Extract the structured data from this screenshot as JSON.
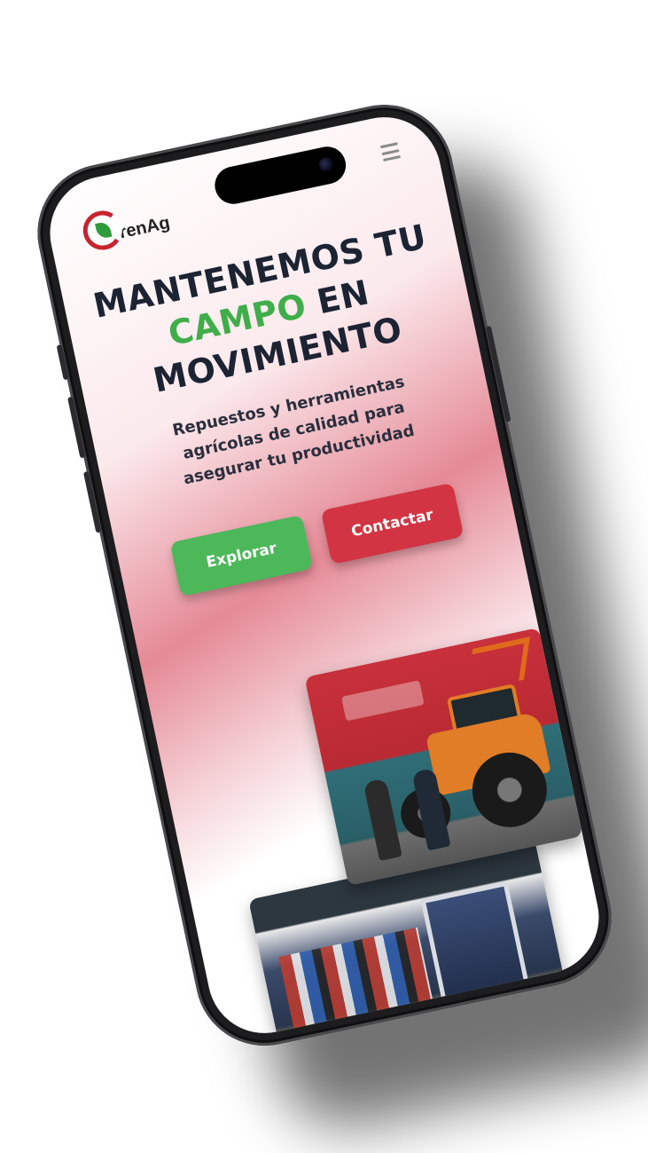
{
  "brand": {
    "logo_text_prefix": "G",
    "logo_text": "renAgro",
    "logo_visible_text": "renAg"
  },
  "hero": {
    "title_line1": "MANTENEMOS TU",
    "title_accent": "CAMPO",
    "title_after_accent": " EN",
    "title_line3": "MOVIMIENTO",
    "subtitle": "Repuestos y herramientas agrícolas de calidad para asegurar tu productividad"
  },
  "actions": {
    "explore_label": "Explorar",
    "contact_label": "Contactar"
  },
  "colors": {
    "accent_green": "#4cb85a",
    "accent_red": "#d23443",
    "title_dark": "#1c2333"
  },
  "icons": {
    "menu": "hamburger-menu-icon",
    "logo": "leaf-logo-icon"
  }
}
